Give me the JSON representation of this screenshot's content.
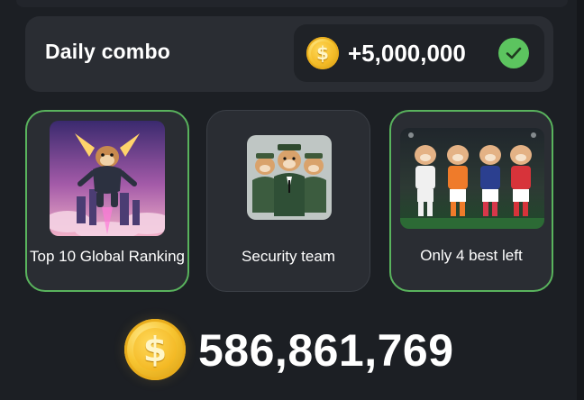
{
  "daily_combo": {
    "title": "Daily combo",
    "reward": "+5,000,000",
    "reward_claimed": true,
    "coin_icon": "dollar-coin-icon",
    "status_icon": "check-icon"
  },
  "cards": [
    {
      "label": "Top 10 Global Ranking",
      "image": "hamster-jetpack-city",
      "completed": true
    },
    {
      "label": "Security team",
      "image": "hamster-security-team",
      "completed": false
    },
    {
      "label": "Only 4 best left",
      "image": "hamster-football-team",
      "completed": true
    }
  ],
  "balance": {
    "value": "586,861,769",
    "coin_icon": "dollar-coin-icon"
  },
  "colors": {
    "background": "#1c1f24",
    "panel": "#2a2d33",
    "pill": "#1f2227",
    "accent_green": "#5cc45f",
    "coin_gold": "#f7c531"
  },
  "coin_symbol": "$"
}
